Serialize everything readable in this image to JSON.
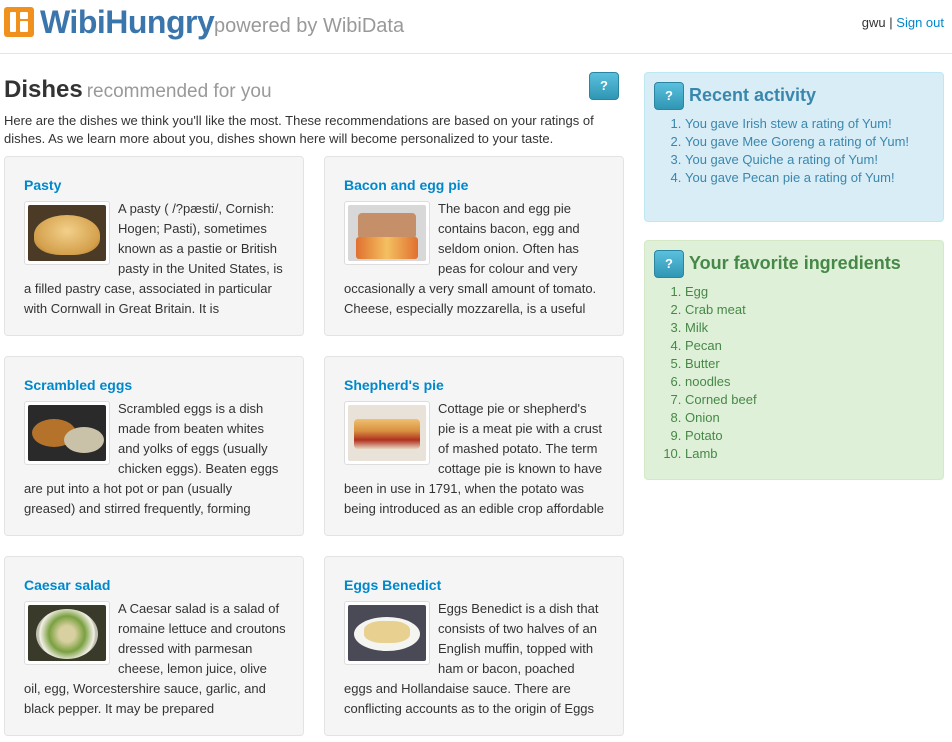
{
  "header": {
    "brand": "WibiHungry",
    "powered_by": "powered by WibiData",
    "username": "gwu",
    "separator": "|",
    "sign_out": "Sign out"
  },
  "main": {
    "title": "Dishes",
    "subtitle": "recommended for you",
    "help_label": "?",
    "intro": "Here are the dishes we think you'll like the most. These recommendations are based on your ratings of dishes. As we learn more about you, dishes shown here will become personalized to your taste.",
    "dishes": [
      {
        "name": "Pasty",
        "description": "A pasty ( /?pæsti/, Cornish: Hogen; Pasti), sometimes known as a pastie or British pasty in the United States, is a filled pastry case, associated in particular with Cornwall in Great Britain. It is"
      },
      {
        "name": "Bacon and egg pie",
        "description": "The bacon and egg pie contains bacon, egg and seldom onion. Often has peas for colour and very occasionally a very small amount of tomato. Cheese, especially mozzarella, is a useful"
      },
      {
        "name": "Scrambled eggs",
        "description": "Scrambled eggs is a dish made from beaten whites and yolks of eggs (usually chicken eggs). Beaten eggs are put into a hot pot or pan (usually greased) and stirred frequently, forming"
      },
      {
        "name": "Shepherd's pie",
        "description": "Cottage pie or shepherd's pie is a meat pie with a crust of mashed potato. The term cottage pie is known to have been in use in 1791, when the potato was being introduced as an edible crop affordable for"
      },
      {
        "name": "Caesar salad",
        "description": "A Caesar salad is a salad of romaine lettuce and croutons dressed with parmesan cheese, lemon juice, olive oil, egg, Worcestershire sauce, garlic, and black pepper. It may be prepared"
      },
      {
        "name": "Eggs Benedict",
        "description": "Eggs Benedict is a dish that consists of two halves of an English muffin, topped with ham or bacon, poached eggs and Hollandaise sauce. There are conflicting accounts as to the origin of Eggs Benedict,"
      }
    ]
  },
  "sidebar": {
    "activity": {
      "title": "Recent activity",
      "help_label": "?",
      "items": [
        "You gave Irish stew a rating of Yum!",
        "You gave Mee Goreng a rating of Yum!",
        "You gave Quiche a rating of Yum!",
        "You gave Pecan pie a rating of Yum!"
      ]
    },
    "ingredients": {
      "title": "Your favorite ingredients",
      "help_label": "?",
      "items": [
        "Egg",
        "Crab meat",
        "Milk",
        "Pecan",
        "Butter",
        "noodles",
        "Corned beef",
        "Onion",
        "Potato",
        "Lamb"
      ]
    }
  },
  "colors": {
    "brand": "#3a75ac",
    "logo": "#f0911e",
    "link": "#0088cc",
    "info_panel": "#d9edf7",
    "success_panel": "#dff0d8"
  }
}
